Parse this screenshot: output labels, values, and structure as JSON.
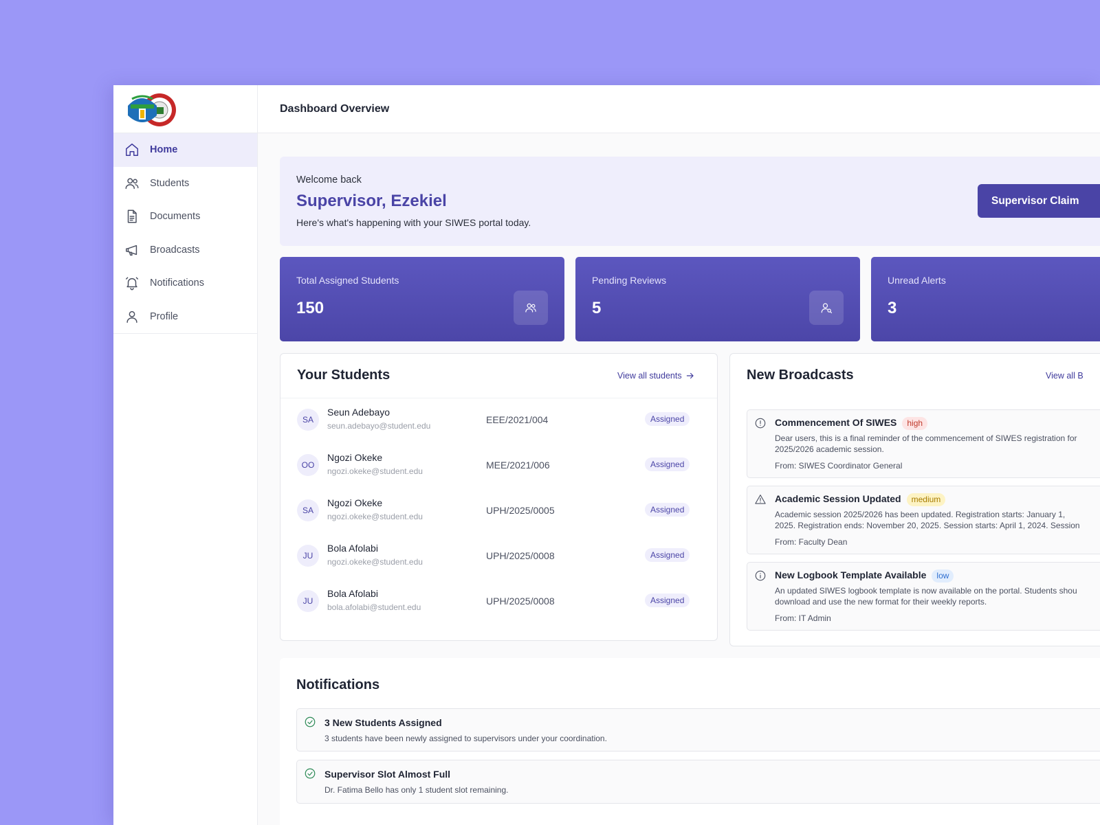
{
  "colors": {
    "brand": "#4a44a6",
    "background": "#9b97f7",
    "accent_soft": "#efeefc"
  },
  "logo": {
    "icon": "university-crest-logo"
  },
  "sidebar": {
    "items": [
      {
        "label": "Home",
        "icon": "home-icon"
      },
      {
        "label": "Students",
        "icon": "users-icon"
      },
      {
        "label": "Documents",
        "icon": "document-icon"
      },
      {
        "label": "Broadcasts",
        "icon": "megaphone-icon"
      },
      {
        "label": "Notifications",
        "icon": "bell-icon"
      },
      {
        "label": "Profile",
        "icon": "user-icon"
      }
    ],
    "active": "Home"
  },
  "header": {
    "title": "Dashboard Overview"
  },
  "welcome": {
    "greeting": "Welcome back",
    "name": "Supervisor, Ezekiel",
    "subtitle": "Here's what's happening with your SIWES portal today.",
    "claim_button": "Supervisor Claim"
  },
  "stats": [
    {
      "label": "Total Assigned Students",
      "value": "150",
      "icon": "users-icon"
    },
    {
      "label": "Pending Reviews",
      "value": "5",
      "icon": "user-search-icon"
    },
    {
      "label": "Unread Alerts",
      "value": "3",
      "icon": "bell-icon"
    }
  ],
  "students": {
    "title": "Your Students",
    "view_all": "View all students",
    "rows": [
      {
        "initials": "SA",
        "name": "Seun Adebayo",
        "email": "seun.adebayo@student.edu",
        "matric": "EEE/2021/004",
        "status": "Assigned"
      },
      {
        "initials": "OO",
        "name": "Ngozi Okeke",
        "email": "ngozi.okeke@student.edu",
        "matric": "MEE/2021/006",
        "status": "Assigned"
      },
      {
        "initials": "SA",
        "name": "Ngozi Okeke",
        "email": "ngozi.okeke@student.edu",
        "matric": "UPH/2025/0005",
        "status": "Assigned"
      },
      {
        "initials": "JU",
        "name": "Bola Afolabi",
        "email": "ngozi.okeke@student.edu",
        "matric": "UPH/2025/0008",
        "status": "Assigned"
      },
      {
        "initials": "JU",
        "name": "Bola Afolabi",
        "email": "bola.afolabi@student.edu",
        "matric": "UPH/2025/0008",
        "status": "Assigned"
      }
    ]
  },
  "broadcasts": {
    "title": "New Broadcasts",
    "view_all": "View all B",
    "items": [
      {
        "title": "Commencement Of SIWES",
        "priority": "high",
        "icon": "info-circle-icon",
        "line1": "Dear users, this is a final reminder of the commencement of SIWES registration for",
        "line2": "2025/2026 academic session.",
        "from": "From: SIWES Coordinator General"
      },
      {
        "title": "Academic Session Updated",
        "priority": "medium",
        "icon": "warning-triangle-icon",
        "line1": "Academic session 2025/2026 has been updated. Registration starts: January 1,",
        "line2": "2025. Registration ends: November 20, 2025. Session starts: April 1, 2024. Session",
        "from": "From: Faculty Dean"
      },
      {
        "title": "New Logbook Template Available",
        "priority": "low",
        "icon": "info-circle-icon",
        "line1": "An updated SIWES logbook template is now available on the portal. Students shou",
        "line2": "download and use the new format for their weekly reports.",
        "from": "From: IT Admin"
      }
    ]
  },
  "notifications": {
    "title": "Notifications",
    "items": [
      {
        "title": "3 New Students Assigned",
        "body": "3 students have been newly assigned to supervisors under your coordination.",
        "icon": "check-circle-icon"
      },
      {
        "title": "Supervisor Slot Almost Full",
        "body": "Dr. Fatima Bello has only 1 student slot remaining.",
        "icon": "check-circle-icon"
      }
    ]
  }
}
